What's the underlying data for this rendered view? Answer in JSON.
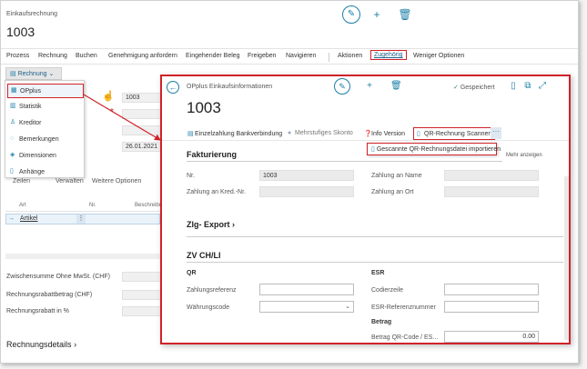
{
  "app": {
    "title": "Einkaufsrechnung",
    "doc_no": "1003"
  },
  "actionbar": {
    "items": [
      "Prozess",
      "Rechnung",
      "Buchen",
      "Genehmigung anfordern",
      "Eingehender Beleg",
      "Freigeben",
      "Navigieren",
      "Aktionen",
      "Zugehörig",
      "Weniger Optionen"
    ]
  },
  "rechnung_button": "Rechnung",
  "menu": {
    "items": [
      {
        "label": "OPplus",
        "icon": "table-icon"
      },
      {
        "label": "Statistik",
        "icon": "chart-icon"
      },
      {
        "label": "Kreditor",
        "icon": "person-icon"
      },
      {
        "label": "Bemerkungen",
        "icon": "comment-icon"
      },
      {
        "label": "Dimensionen",
        "icon": "dimensions-icon"
      },
      {
        "label": "Anhänge",
        "icon": "attachment-icon"
      }
    ]
  },
  "background_form": {
    "field1": "1003",
    "date": "26.01.2021",
    "tabs": [
      "Zeilen",
      "Verwalten",
      "Weitere Optionen"
    ],
    "grid_headers": [
      "Art",
      "Nr.",
      "Beschreibu"
    ],
    "grid_row_art": "Artikel",
    "labels": [
      "Zwischensumme Ohne MwSt. (CHF)",
      "Rechnungsrabattbetrag (CHF)",
      "Rechnungsrabatt in %"
    ],
    "section": "Rechnungsdetails"
  },
  "popup": {
    "title": "OPplus Einkaufsinformationen",
    "saved": "Gespeichert",
    "doc_no": "1003",
    "actions": {
      "einzel": "Einzelzahlung Bankverbindung",
      "skonto": "Mehrstufiges Skonto",
      "info": "Info Version",
      "qr": "QR-Rechnung Scannen",
      "more": "···"
    },
    "dropdown_item": "Gescannte QR-Rechnungsdatei importieren",
    "mehr_anzeigen": "Mehr anzeigen",
    "fakturierung": {
      "title": "Fakturierung",
      "nr_label": "Nr.",
      "nr_value": "1003",
      "zahlung_kred_label": "Zahlung an Kred.-Nr.",
      "zahlung_name_label": "Zahlung an Name",
      "zahlung_ort_label": "Zahlung an Ort"
    },
    "zlg_export": {
      "title": "Zlg- Export"
    },
    "zv": {
      "title": "ZV CH/LI",
      "qr": "QR",
      "esr": "ESR",
      "zahlungsreferenz": "Zahlungsreferenz",
      "waehrungscode": "Währungscode",
      "codierzeile": "Codierzeile",
      "esr_ref": "ESR-Referenznummer",
      "betrag": "Betrag",
      "betrag_qr_label": "Betrag QR-Code / ES...",
      "betrag_qr_value": "0.00"
    }
  },
  "colors": {
    "accent": "#1c7fa8",
    "highlight": "#d0222a"
  }
}
